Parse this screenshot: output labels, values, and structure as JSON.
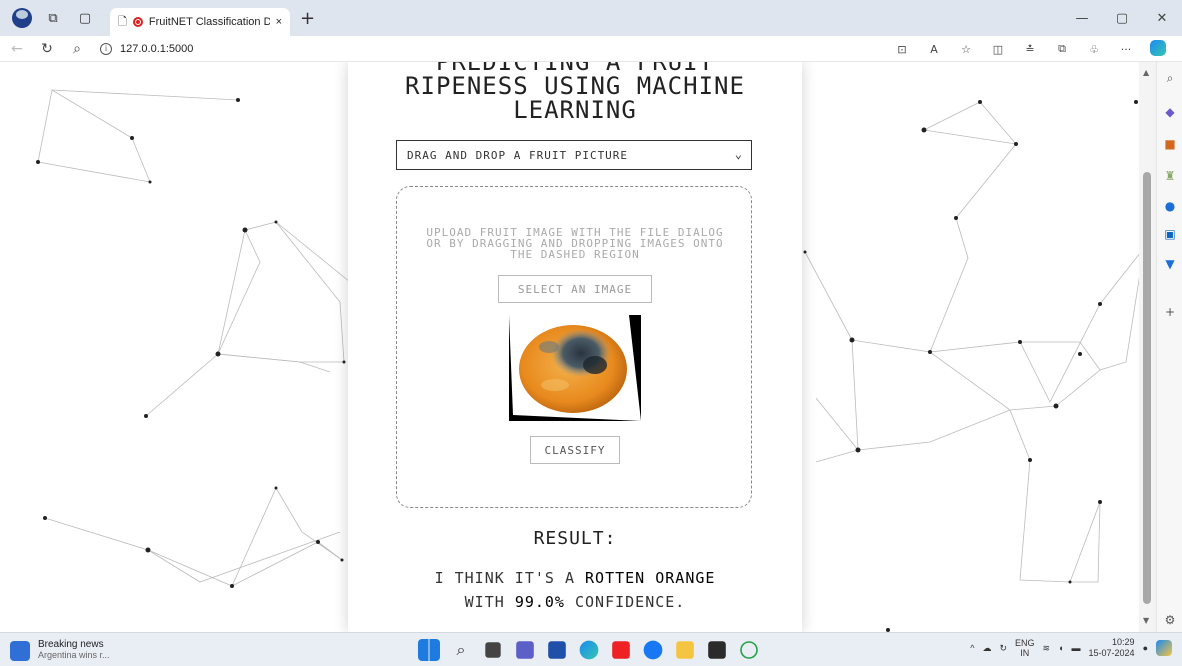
{
  "browser": {
    "tab_title": "FruitNET Classification Dem",
    "tab_close": "×",
    "new_tab": "+",
    "url": "127.0.0.1:5000"
  },
  "page": {
    "title_line1": "PREDICTING A FRUIT",
    "title_line2": "RIPENESS USING MACHINE",
    "title_line3": "LEARNING",
    "select_value": "DRAG AND DROP A FRUIT PICTURE",
    "upload_hint": "UPLOAD FRUIT IMAGE WITH THE FILE DIALOG OR BY DRAGGING AND DROPPING IMAGES ONTO THE DASHED REGION",
    "select_image_label": "SELECT AN IMAGE",
    "classify_label": "CLASSIFY",
    "result_title": "RESULT:",
    "result_prefix": "I THINK IT'S A",
    "result_fruit": "ROTTEN ORANGE",
    "result_with": "WITH",
    "result_confidence": "99.0%",
    "result_suffix": "CONFIDENCE."
  },
  "taskbar": {
    "news_title": "Breaking news",
    "news_sub": "Argentina wins r...",
    "lang": "ENG",
    "lang_region": "IN",
    "time": "10:29",
    "date": "15-07-2024"
  },
  "colors": {
    "accent": "#1b8af0",
    "record": "#dd2222"
  }
}
